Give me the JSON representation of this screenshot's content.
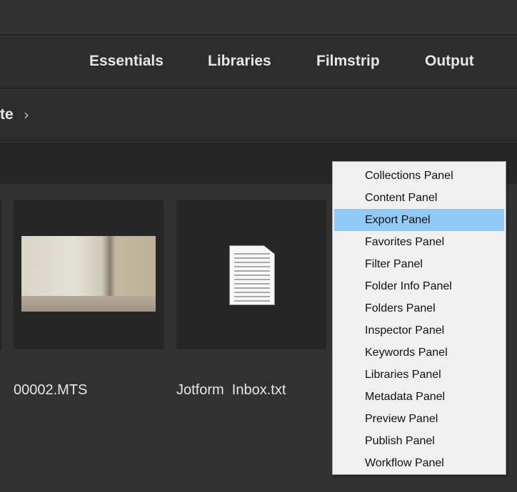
{
  "workspaces": [
    "Essentials",
    "Libraries",
    "Filmstrip",
    "Output"
  ],
  "breadcrumb": {
    "label": "te",
    "separator": "›"
  },
  "files": [
    {
      "name": "00002.MTS",
      "type": "video-thumbnail"
    },
    {
      "name": "Jotform  Inbox.txt",
      "type": "text-document-icon"
    }
  ],
  "menu": {
    "items": [
      "Collections Panel",
      "Content Panel",
      "Export Panel",
      "Favorites Panel",
      "Filter Panel",
      "Folder Info Panel",
      "Folders Panel",
      "Inspector Panel",
      "Keywords Panel",
      "Libraries Panel",
      "Metadata Panel",
      "Preview Panel",
      "Publish Panel",
      "Workflow Panel"
    ],
    "highlighted": "Export Panel",
    "highlight_color": "#91c9f7"
  }
}
